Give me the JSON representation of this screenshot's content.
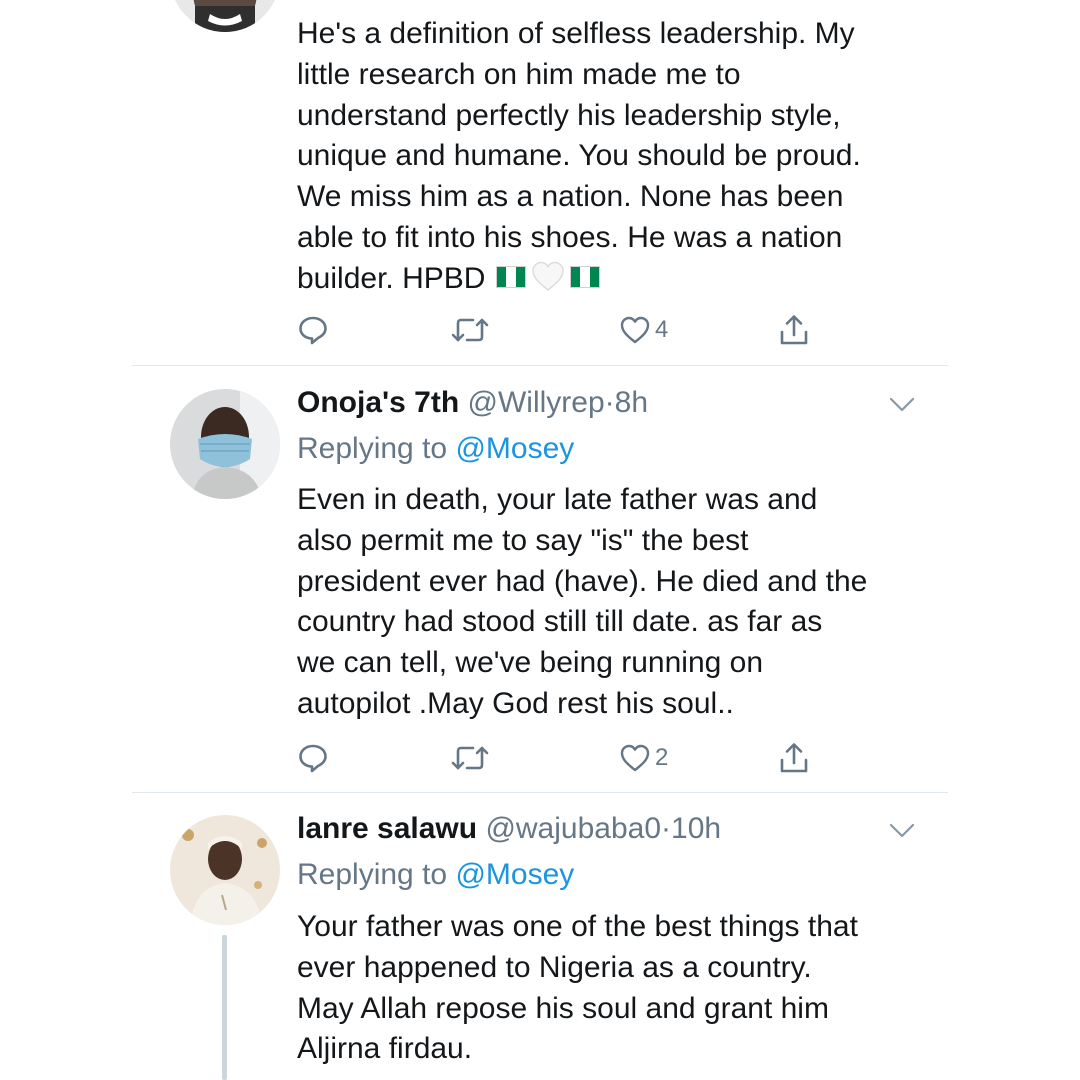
{
  "tweets": [
    {
      "body": "He's a definition of selfless leadership. My\nlittle research on him made me to\nunderstand perfectly his leadership style,\nunique and humane. You should be proud.\nWe miss him as a nation. None has been\nable to fit into his shoes. He was a nation\nbuilder. HPBD",
      "likes": "4"
    },
    {
      "display_name": "Onoja's 7th",
      "handle": "@Willyrep",
      "separator": "·",
      "time": "8h",
      "replying_prefix": "Replying to ",
      "replying_handle": "@Mosey",
      "body": "Even in death, your late father was and\nalso permit me to say \"is\" the best\npresident ever had (have). He died and the\ncountry had stood still till date. as far as\nwe can tell, we've being running on\nautopilot  .May God rest his soul..",
      "likes": "2"
    },
    {
      "display_name": "lanre salawu",
      "handle": "@wajubaba0",
      "separator": "·",
      "time": "10h",
      "replying_prefix": "Replying to ",
      "replying_handle": "@Mosey",
      "body": "Your father was one of the best things that\never happened to Nigeria as a country.\nMay Allah repose his soul and grant him\nAljirna firdau."
    }
  ],
  "icons": {
    "reply": "reply-icon",
    "retweet": "retweet-icon",
    "like": "heart-icon",
    "share": "share-icon",
    "more": "chevron-down-icon",
    "flag": "nigeria-flag-emoji",
    "white_heart": "white-heart-emoji"
  },
  "colors": {
    "text": "#14171a",
    "secondary": "#657786",
    "link": "#1b95e0",
    "divider": "#e1e8ed",
    "thread_line": "#ccd6dd",
    "flag_green": "#008751"
  }
}
